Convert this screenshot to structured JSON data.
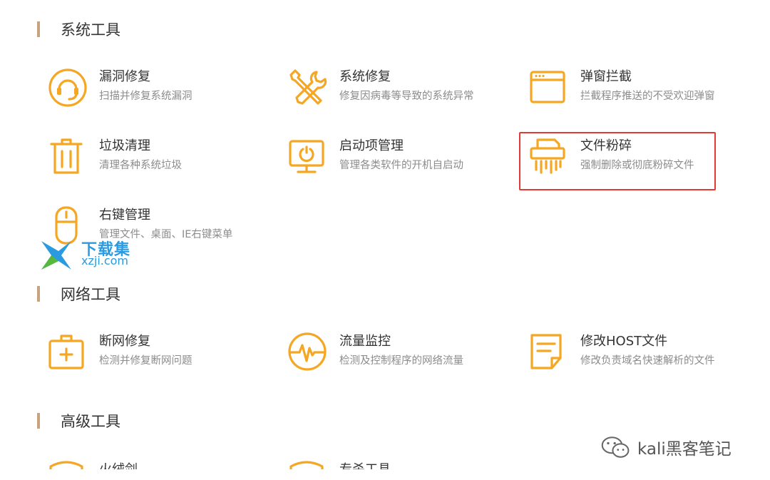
{
  "sections": {
    "system": {
      "title": "系统工具"
    },
    "network": {
      "title": "网络工具"
    },
    "advanced": {
      "title": "高级工具"
    }
  },
  "tools": {
    "vuln_repair": {
      "name": "漏洞修复",
      "desc": "扫描并修复系统漏洞",
      "icon": "headset-circle-icon"
    },
    "system_repair": {
      "name": "系统修复",
      "desc": "修复因病毒等导致的系统异常",
      "icon": "wrench-screwdriver-icon"
    },
    "popup_block": {
      "name": "弹窗拦截",
      "desc": "拦截程序推送的不受欢迎弹窗",
      "icon": "browser-window-icon"
    },
    "junk_clean": {
      "name": "垃圾清理",
      "desc": "清理各种系统垃圾",
      "icon": "trash-bin-icon"
    },
    "startup_manager": {
      "name": "启动项管理",
      "desc": "管理各类软件的开机自启动",
      "icon": "monitor-power-icon"
    },
    "file_shredder": {
      "name": "文件粉碎",
      "desc": "强制删除或彻底粉碎文件",
      "icon": "shredder-icon"
    },
    "context_menu": {
      "name": "右键管理",
      "desc": "管理文件、桌面、IE右键菜单",
      "icon": "mouse-icon"
    },
    "network_repair": {
      "name": "断网修复",
      "desc": "检测并修复断网问题",
      "icon": "medkit-icon"
    },
    "traffic_monitor": {
      "name": "流量监控",
      "desc": "检测及控制程序的网络流量",
      "icon": "pulse-circle-icon"
    },
    "host_edit": {
      "name": "修改HOST文件",
      "desc": "修改负责域名快速解析的文件",
      "icon": "note-document-icon"
    },
    "advanced_1": {
      "name": "火绒剑",
      "icon": "shield-icon"
    },
    "advanced_2": {
      "name": "专杀工具",
      "icon": "shield-icon"
    }
  },
  "watermark": {
    "cn": "下载集",
    "en": "xzji.com"
  },
  "credit": {
    "text": "kali黑客笔记"
  },
  "colors": {
    "accent": "#f5a623",
    "section_bar": "#c9a27e",
    "highlight": "#e53935",
    "watermark": "#2a9be0"
  }
}
